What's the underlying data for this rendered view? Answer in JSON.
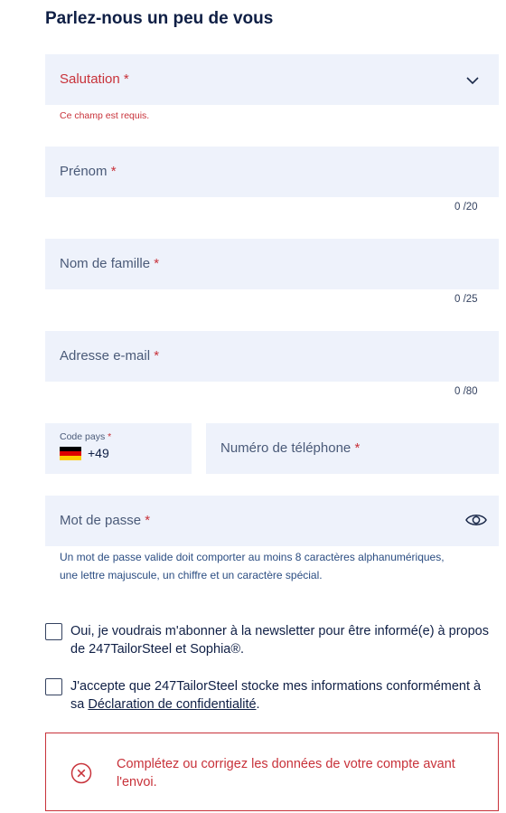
{
  "title": "Parlez-nous un peu de vous",
  "salutation": {
    "label": "Salutation",
    "required": "*",
    "error": "Ce champ est requis."
  },
  "first_name": {
    "label": "Prénom",
    "required": "*",
    "counter": "0 /20"
  },
  "last_name": {
    "label": "Nom de famille",
    "required": "*",
    "counter": "0 /25"
  },
  "email": {
    "label": "Adresse e-mail",
    "required": "*",
    "counter": "0 /80"
  },
  "country_code": {
    "label": "Code pays",
    "required": "*",
    "value": "+49",
    "flag": "germany-flag"
  },
  "phone": {
    "label": "Numéro de téléphone",
    "required": "*"
  },
  "password": {
    "label": "Mot de passe",
    "required": "*",
    "hint": "Un mot de passe valide doit comporter au moins 8 caractères alphanumériques, une lettre majuscule, un chiffre et un caractère spécial."
  },
  "newsletter": {
    "label": "Oui, je voudrais m'abonner à la newsletter pour être informé(e) à propos de 247TailorSteel et Sophia®.",
    "checked": false
  },
  "privacy": {
    "label_before": "J'accepte que 247TailorSteel stocke mes informations conformément à sa ",
    "link": "Déclaration de confidentialité",
    "label_after": ".",
    "checked": false
  },
  "alert": {
    "message": "Complétez ou corrigez les données de votre compte avant l'envoi."
  },
  "colors": {
    "field_bg": "#eef2fb",
    "error": "#c8323a",
    "navy": "#0f1f45",
    "hint": "#2b4d82"
  }
}
